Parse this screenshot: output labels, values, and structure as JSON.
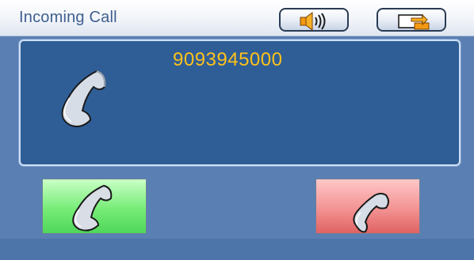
{
  "window": {
    "title": "Incoming Call"
  },
  "call": {
    "number": "9093945000"
  },
  "toolbar": {
    "speaker_icon": "speaker-icon",
    "switch_icon": "transfer-arrow-icon"
  },
  "actions": {
    "answer_icon": "handset-answer-icon",
    "reject_icon": "handset-hangup-icon"
  },
  "colors": {
    "number_text": "#ffc21a",
    "panel_bg": "#2f5e96",
    "answer_green": "#77ec77",
    "reject_red": "#f39393"
  }
}
